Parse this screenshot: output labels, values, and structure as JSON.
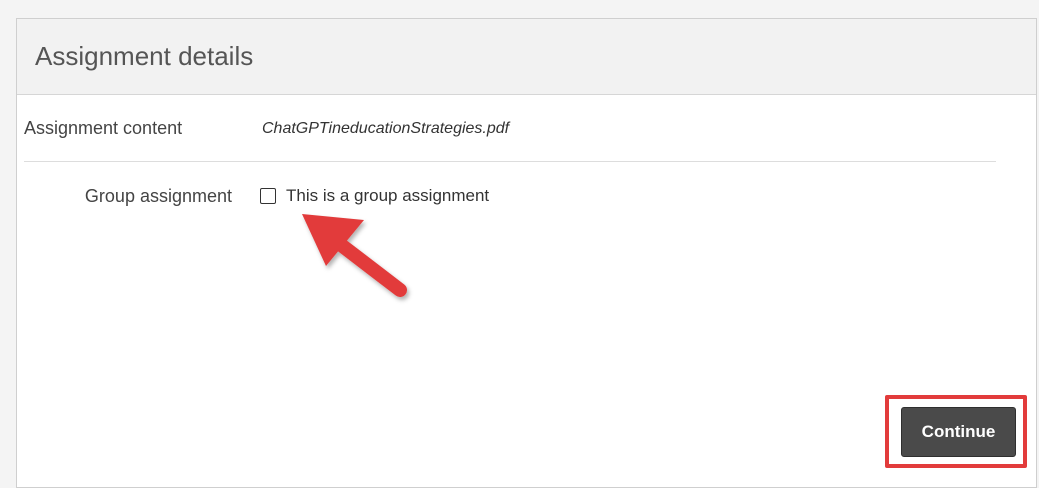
{
  "panel": {
    "title": "Assignment details"
  },
  "fields": {
    "content_label": "Assignment content",
    "content_value": "ChatGPTineducationStrategies.pdf",
    "group_label": "Group assignment",
    "group_checkbox_label": "This is a group assignment",
    "group_checked": false
  },
  "actions": {
    "continue_label": "Continue"
  },
  "colors": {
    "annotation_red": "#e23b3b",
    "button_dark": "#4a4a4a"
  }
}
